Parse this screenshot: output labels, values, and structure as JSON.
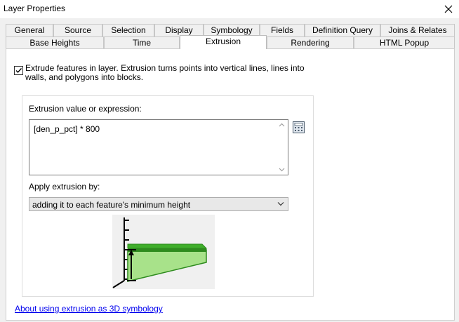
{
  "window": {
    "title": "Layer Properties"
  },
  "tabs_row1": [
    "General",
    "Source",
    "Selection",
    "Display",
    "Symbology",
    "Fields",
    "Definition Query",
    "Joins & Relates"
  ],
  "tabs_row2": [
    "Base Heights",
    "Time",
    "Extrusion",
    "Rendering",
    "HTML Popup"
  ],
  "selected_tab": "Extrusion",
  "extrude": {
    "checked": true,
    "label_line1": "Extrude features in layer.  Extrusion turns points into vertical lines, lines into",
    "label_line2": "walls, and polygons into blocks."
  },
  "expression": {
    "label": "Extrusion value or expression:",
    "value": "[den_p_pct] * 800"
  },
  "apply": {
    "label": "Apply extrusion by:",
    "selected": "adding it to each feature's minimum height"
  },
  "help_link": "About using extrusion as 3D symbology",
  "icons": {
    "close": "close-icon",
    "calculator": "calculator-icon",
    "preview": "extrusion-preview-diagram"
  },
  "colors": {
    "preview_green": "#6cc04a",
    "preview_dark_green": "#2e8b1e",
    "link": "#0000ee"
  }
}
